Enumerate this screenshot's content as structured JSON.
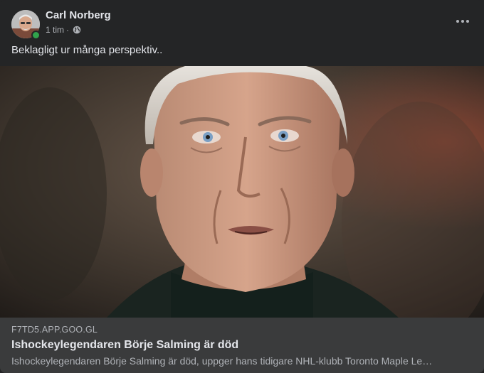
{
  "post": {
    "author": "Carl Norberg",
    "time": "1 tim",
    "separator": "·",
    "audience_icon": "globe-icon",
    "more_icon": "more-options-icon",
    "text": "Beklagligt ur många perspektiv..",
    "online": true
  },
  "link_preview": {
    "domain": "F7TD5.APP.GOO.GL",
    "title": "Ishockeylegendaren Börje Salming är död",
    "description": "Ishockeylegendaren Börje Salming är död, uppger hans tidigare NHL-klubb Toronto Maple Le…",
    "image": "portrait-photo of elderly man with grey hair"
  },
  "colors": {
    "background": "#242526",
    "link_box": "#3a3b3c",
    "primary_text": "#e4e6eb",
    "secondary_text": "#b0b3b8",
    "online_green": "#31a24c"
  }
}
